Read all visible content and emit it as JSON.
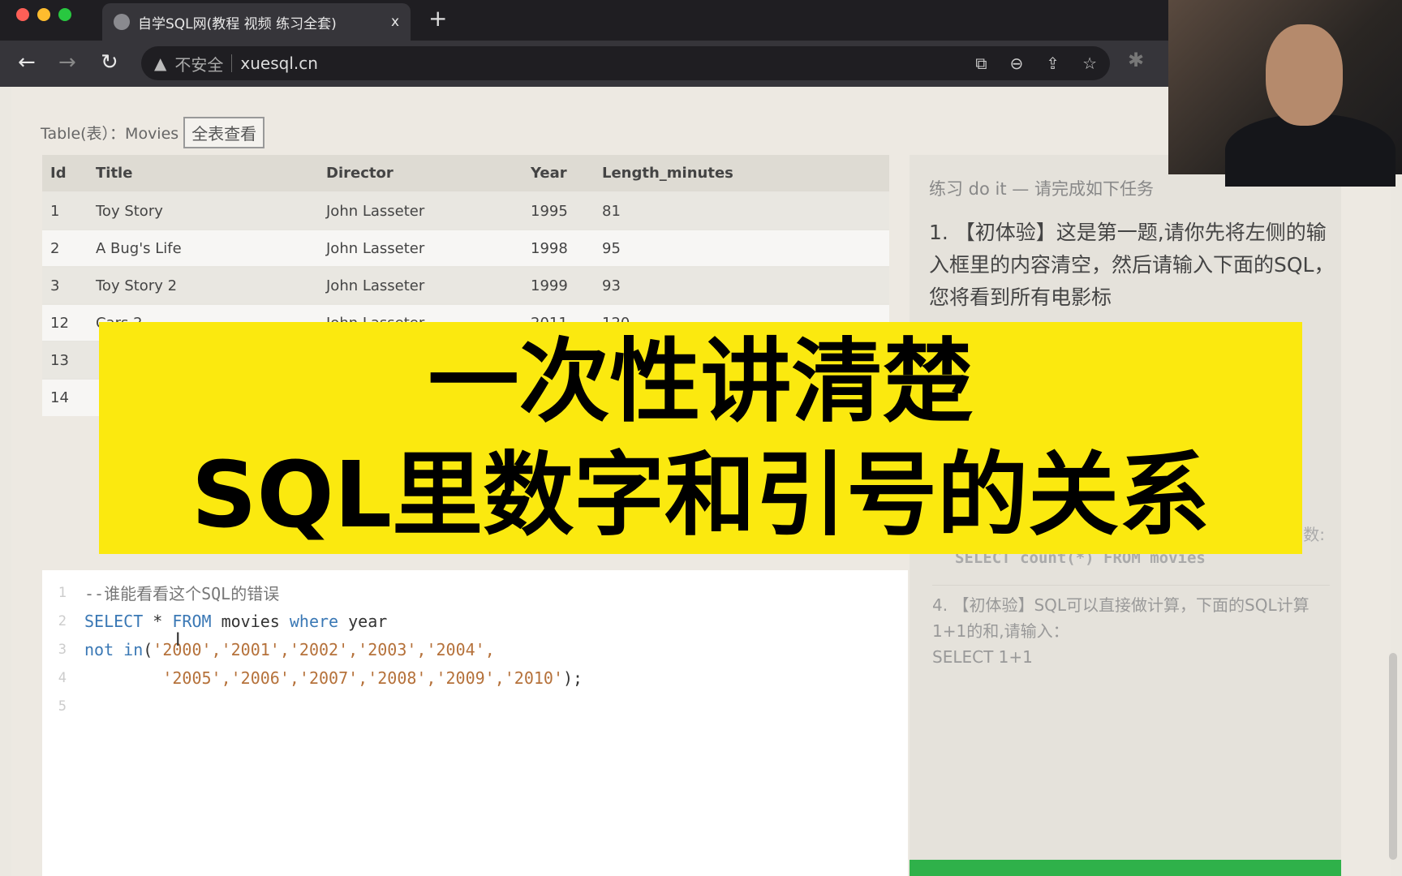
{
  "browser": {
    "tab_title": "自学SQL网(教程 视频 练习全套)",
    "tab_close": "x",
    "new_tab": "+",
    "security": "不安全",
    "url": "xuesql.cn",
    "back": "←",
    "forward": "→",
    "reload": "↻"
  },
  "table_section": {
    "label": "Table(表）：Movies",
    "view_all": "全表查看",
    "columns": [
      "Id",
      "Title",
      "Director",
      "Year",
      "Length_minutes"
    ],
    "rows": [
      [
        "1",
        "Toy Story",
        "John Lasseter",
        "1995",
        "81"
      ],
      [
        "2",
        "A Bug's Life",
        "John Lasseter",
        "1998",
        "95"
      ],
      [
        "3",
        "Toy Story 2",
        "John Lasseter",
        "1999",
        "93"
      ],
      [
        "12",
        "Cars 2",
        "John Lasseter",
        "2011",
        "120"
      ],
      [
        "13",
        "",
        "",
        "",
        ""
      ],
      [
        "14",
        "",
        "",
        "",
        ""
      ]
    ]
  },
  "editor": {
    "lines": [
      "1",
      "2",
      "3",
      "4",
      "5"
    ],
    "comment": "--谁能看看这个SQL的错误",
    "kw_select": "SELECT",
    "star": " * ",
    "kw_from": "FROM",
    "tbl": " movies ",
    "kw_where": "where",
    "col": " year",
    "kw_notin": "not in",
    "paren": "(",
    "vals1": "'2000','2001','2002','2003','2004',",
    "vals2": "'2005','2006','2007','2008','2009','2010'",
    "end": ");"
  },
  "panel": {
    "heading": "练习 do it — 请完成如下任务",
    "task1": "1. 【初体验】这是第一题,请你先将左侧的输入框里的内容清空，然后请输入下面的SQL，您将看到所有电影标",
    "task3_suffix": "数:",
    "task3_sql": "SELECT count(*) FROM movies",
    "task4": "4. 【初体验】SQL可以直接做计算，下面的SQL计算1+1的和,请输入：",
    "task4_sql": "SELECT 1+1"
  },
  "banner": {
    "line1": "一次性讲清楚",
    "line2": "SQL里数字和引号的关系"
  },
  "colors": {
    "banner": "#fbe90f",
    "keyword": "#3a78b5",
    "string": "#b5713a",
    "green_bar": "#2fb14a"
  }
}
